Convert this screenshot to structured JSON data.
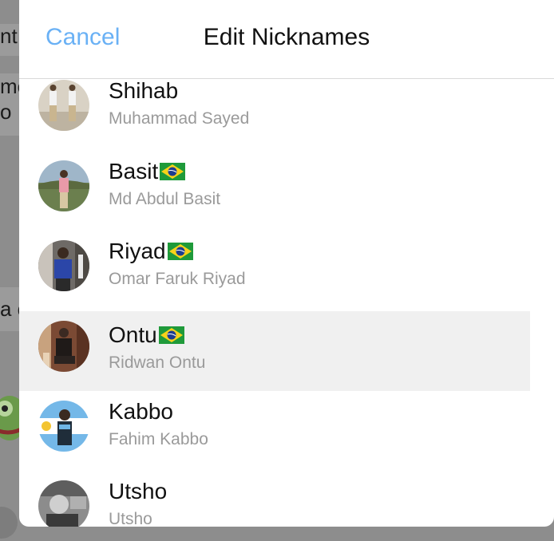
{
  "header": {
    "cancel_label": "Cancel",
    "title": "Edit Nicknames"
  },
  "background": {
    "strip_texts": [
      "nt",
      "me",
      "o :",
      "a c"
    ]
  },
  "nicknames": [
    {
      "nickname": "Shihab",
      "full_name": "Muhammad Sayed",
      "flag": "",
      "avatar": "beige-outdoor-avatar"
    },
    {
      "nickname": "Basit",
      "full_name": "Md Abdul Basit",
      "flag": "brazil-flag",
      "avatar": "landscape-avatar"
    },
    {
      "nickname": "Riyad",
      "full_name": "Omar Faruk Riyad",
      "flag": "brazil-flag",
      "avatar": "dark-indoor-avatar"
    },
    {
      "nickname": "Ontu",
      "full_name": "Ridwan Ontu",
      "flag": "brazil-flag",
      "avatar": "warm-avatar",
      "selected": true
    },
    {
      "nickname": "Kabbo",
      "full_name": "Fahim Kabbo",
      "flag": "",
      "avatar": "argentina-avatar"
    },
    {
      "nickname": "Utsho",
      "full_name": "Utsho",
      "flag": "",
      "avatar": "grayscale-avatar"
    }
  ],
  "colors": {
    "accent": "#6ab1f5",
    "selected_row": "#f0f0f0",
    "subtitle": "#9a9a9a"
  }
}
